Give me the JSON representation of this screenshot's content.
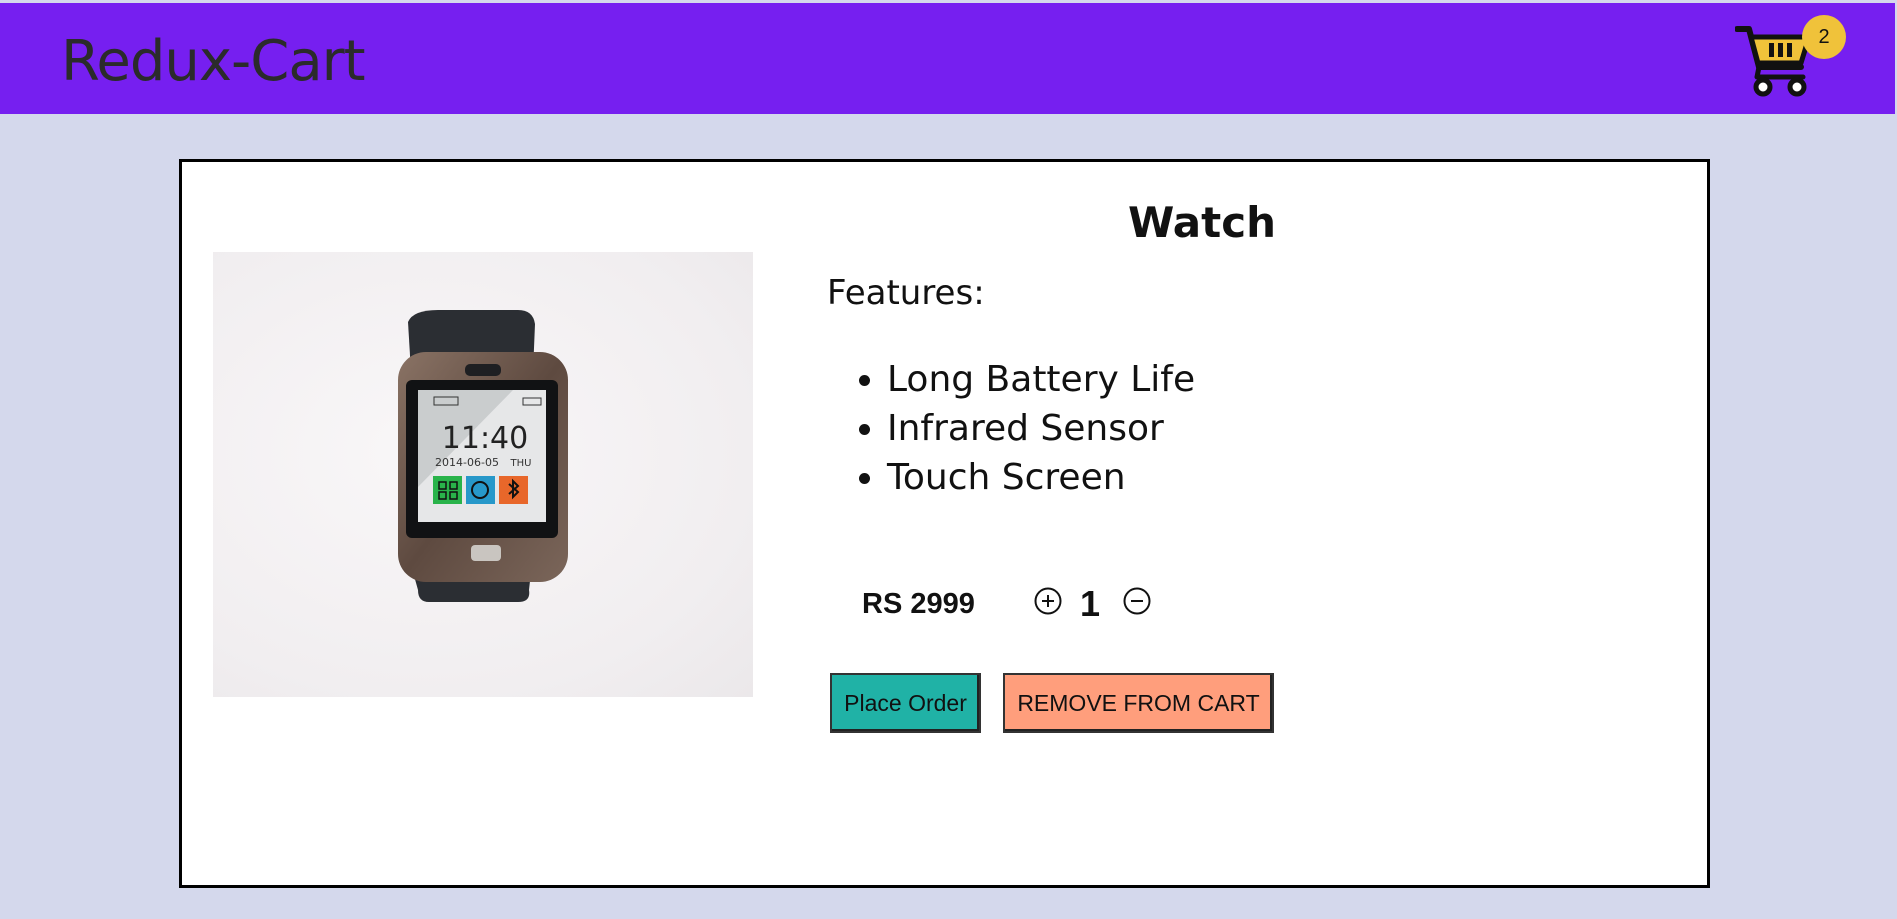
{
  "header": {
    "brand": "Redux-Cart",
    "cart_icon": "shopping-cart-icon",
    "cart_count": "2",
    "background_color": "#761ff0",
    "badge_color": "#f0c23a"
  },
  "product": {
    "title": "Watch",
    "image_icon": "smartwatch-product-image",
    "features_label": "Features:",
    "features": [
      "Long Battery Life",
      "Infrared Sensor",
      "Touch Screen"
    ],
    "price": "RS 2999",
    "quantity": "1",
    "increment_icon": "plus-circle-icon",
    "decrement_icon": "minus-circle-icon"
  },
  "actions": {
    "place_order_label": "Place Order",
    "remove_label": "REMOVE FROM CART",
    "place_order_color": "#20b2a6",
    "remove_color": "#ff9e7c"
  },
  "watch_screen": {
    "time": "11:40",
    "date": "2014-06-05",
    "day": "THU"
  }
}
